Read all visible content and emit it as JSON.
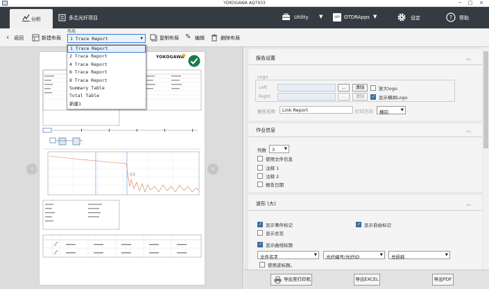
{
  "window": {
    "title": "YOKOGAWA AQ7933",
    "controls": [
      "−",
      "□",
      "×"
    ]
  },
  "topbar": {
    "tabs": [
      {
        "label": "分析",
        "icon": "analysis-icon",
        "active": true
      },
      {
        "label": "多芯光纤项目",
        "icon": "project-icon",
        "active": false
      }
    ],
    "buttons": [
      {
        "label": "Utility",
        "icon": "toolbox-icon"
      },
      {
        "label": "OTDRApps",
        "icon": "app-icon",
        "badge": "APP"
      },
      {
        "label": "设定",
        "icon": "gear-icon"
      },
      {
        "label": "帮助",
        "icon": "help-icon"
      }
    ]
  },
  "toolbar": {
    "back_label": "返回",
    "new_layout_label": "新建布局",
    "layout_label": "布局",
    "layout_value": "1 Trace Report",
    "copy_layout_label": "复制布局",
    "edit_label": "编辑",
    "delete_layout_label": "删除布局"
  },
  "layout_dropdown": {
    "items": [
      "1 Trace Report",
      "2 Trace Report",
      "4 Trace Report",
      "6 Trace Report",
      "8 Trace Report",
      "Summary Table",
      "Total Table",
      "新建1"
    ],
    "selected_index": 0
  },
  "preview": {
    "logo_text": "YOKOGAWA",
    "prev_arrow": "‹",
    "next_arrow": "›"
  },
  "report_settings": {
    "title": "报告设置",
    "logo_group_label": "Logo",
    "left_label": "Left",
    "right_label": "Right",
    "browse_label": "...",
    "clear_label": "清除",
    "enlarge_logo_label": "放大logo",
    "enlarge_logo_checked": false,
    "show_landscape_logo_label": "显示横闻Logo",
    "show_landscape_logo_checked": true,
    "report_name_label": "报告名称",
    "report_name_value": "Link Report",
    "print_direction_label": "打印方向",
    "print_direction_value": "横向"
  },
  "job_info": {
    "title": "作业信息",
    "columns_label": "列数",
    "columns_value": "3",
    "use_file_info_label": "使用文件信息",
    "use_file_info_checked": false,
    "note1_label": "注释 1",
    "note1_checked": false,
    "note2_label": "注释 2",
    "note2_checked": false,
    "report_date_label": "报告日期",
    "report_date_checked": false
  },
  "waveform": {
    "title": "波形 (大)",
    "show_event_marker_label": "显示事件标记",
    "show_event_marker_checked": true,
    "show_free_marker_label": "显示自由标记",
    "show_free_marker_checked": true,
    "show_total_loss_label": "显示总览",
    "show_total_loss_checked": false,
    "show_curve_title_label": "显示曲线标题",
    "show_curve_title_checked": true,
    "file_name_value": "文件名字",
    "fiber_id_value": "光纤编号/光纤ID",
    "total_loss_value": "总损耗",
    "use_trace_title_label": "使用迹标题。",
    "use_trace_title_checked": false
  },
  "bottom_buttons": {
    "export_printer_label": "导出至打印机",
    "export_excel_label": "导出EXCEL",
    "export_pdf_label": "导出PDF"
  },
  "colors": {
    "accent": "#3b7bd4",
    "topbar": "#353b43",
    "checkbox": "#3c6e9f",
    "check_badge": "#1a7a4c",
    "trace": "#d9745a"
  }
}
